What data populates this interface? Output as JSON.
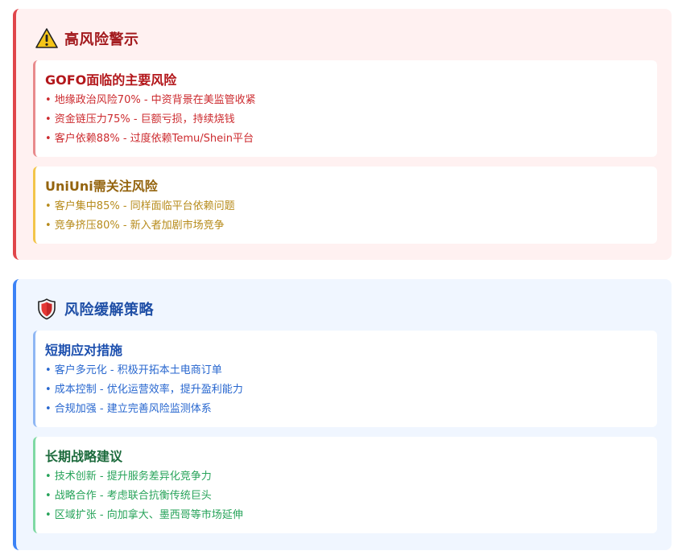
{
  "risk_panel": {
    "icon": "warning-icon",
    "title": "高风险警示",
    "accent": "#e0454a",
    "cards": [
      {
        "title": "GOFO面临的主要风险",
        "items": [
          "• 地缘政治风险70% - 中资背景在美监管收紧",
          "• 资金链压力75% - 巨额亏损，持续烧钱",
          "• 客户依赖88% - 过度依赖Temu/Shein平台"
        ]
      },
      {
        "title": "UniUni需关注风险",
        "items": [
          "• 客户集中85% - 同样面临平台依赖问题",
          "• 竞争挤压80% - 新入者加剧市场竞争"
        ]
      }
    ]
  },
  "strategy_panel": {
    "icon": "shield-icon",
    "title": "风险缓解策略",
    "accent": "#3b82f6",
    "cards": [
      {
        "title": "短期应对措施",
        "items": [
          "• 客户多元化 - 积极开拓本土电商订单",
          "• 成本控制 - 优化运营效率，提升盈利能力",
          "• 合规加强 - 建立完善风险监测体系"
        ]
      },
      {
        "title": "长期战略建议",
        "items": [
          "• 技术创新 - 提升服务差异化竞争力",
          "• 战略合作 - 考虑联合抗衡传统巨头",
          "• 区域扩张 - 向加拿大、墨西哥等市场延伸"
        ]
      }
    ]
  }
}
